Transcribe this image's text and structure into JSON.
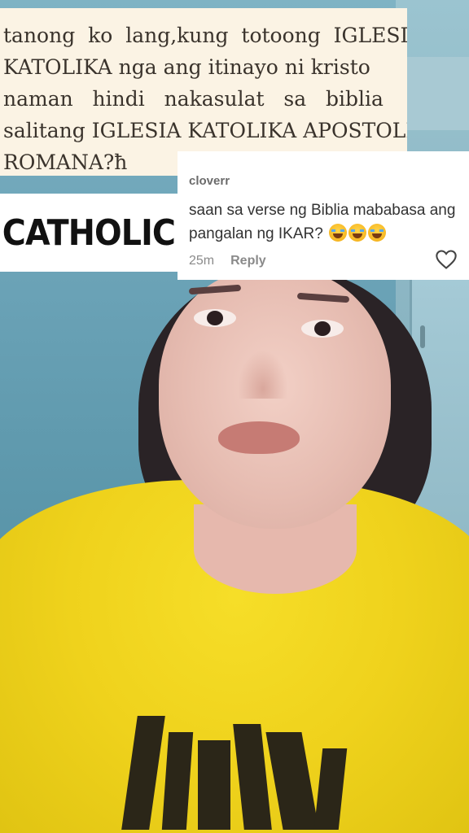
{
  "article": {
    "lines": [
      "tanong  ko  lang,kung  totoong  IGLESIA",
      "KATOLIKA nga ang itinayo ni kristo",
      "naman   hindi   nakasulat   sa   biblia",
      "salitang IGLESIA KATOLIKA APOSTOLIKA",
      "ROMANA?ħ"
    ]
  },
  "overlay_label": "CATHOLIC",
  "comment": {
    "username": "cloverr",
    "text_line1": "saan sa verse ng Biblia mababasa ang",
    "text_line2": "pangalan ng IKAR?",
    "emoji": [
      "laughing-tears-emoji",
      "laughing-tears-emoji",
      "laughing-tears-emoji"
    ],
    "time": "25m",
    "reply_label": "Reply"
  }
}
